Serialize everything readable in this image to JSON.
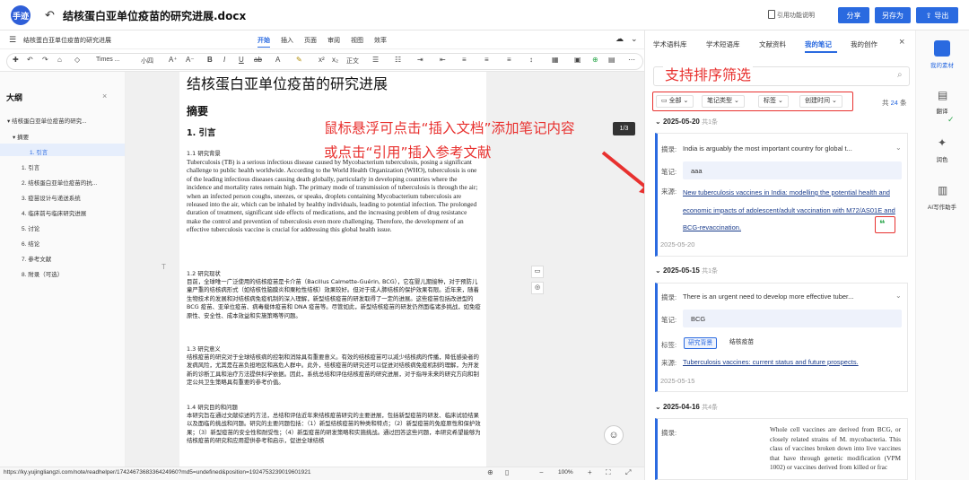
{
  "titlebar": {
    "logo": "手迹",
    "back_icon": "undo-icon",
    "title": "结核蛋白亚单位疫苗的研究进展.docx",
    "cite_help": "引用功能说明",
    "share": "分享",
    "save_as": "另存为",
    "export": "导出"
  },
  "doc_header": {
    "name": "结核蛋白亚单位疫苗的研究进展",
    "menu": [
      "开始",
      "插入",
      "页面",
      "审阅",
      "视图",
      "效率"
    ]
  },
  "toolbar": {
    "font": "Times ...",
    "size": "小四",
    "align": "正文"
  },
  "outline": {
    "title": "大纲",
    "items": [
      "结核蛋白亚单位疫苗的研究...",
      "摘要",
      "1. 引言",
      "1. 引言",
      "2. 结核蛋白亚单位疫苗的抗...",
      "3. 疫苗设计与递送系统",
      "4. 临床前与临床研究进展",
      "5. 讨论",
      "6. 结论",
      "7. 参考文献",
      "8. 附录（可选）"
    ]
  },
  "document": {
    "title": "结核蛋白亚单位疫苗的研究进展",
    "abstract": "摘要",
    "h1": "1.  引言",
    "s11": "1.1 研究背景",
    "p11": "Tuberculosis (TB) is a serious infectious disease caused by Mycobacterium tuberculosis, posing a significant challenge to public health worldwide. According to the World Health Organization (WHO), tuberculosis is one of the leading infectious diseases causing death globally, particularly in developing countries where the incidence and mortality rates remain high. The primary mode of transmission of tuberculosis is through the air; when an infected person coughs, sneezes, or speaks, droplets containing Mycobacterium tuberculosis are released into the air, which can be inhaled by healthy individuals, leading to potential infection. The prolonged duration of treatment, significant side effects of medications, and the increasing problem of drug resistance make the control and prevention of tuberculosis even more challenging. Therefore, the development of an effective tuberculosis vaccine is crucial for addressing this global health issue.",
    "s12": "1.2 研究现状",
    "p12": "目前，全球唯一广泛使用的结核疫苗是卡介苗（Bacillus Calmette-Guérin, BCG），它在婴儿期接种，对于预防儿童严重的结核病形式（如结核性脑膜炎和粟粒性结核）效果较好。但对于成人肺结核的保护效果有限。近年来，随着生物技术的发展和对结核病免疫机制的深入理解，新型结核疫苗的研发取得了一定的进展。这些疫苗包括改进型的 BCG 疫苗、亚单位疫苗、病毒载体疫苗和 DNA 疫苗等。尽管如此，新型结核疫苗的研发仍然面临诸多挑战，如免疫原性、安全性、成本效益和实施策略等问题。",
    "s13": "1.3 研究意义",
    "p13": "结核疫苗的研究对于全球结核病的控制和消除具有重要意义。有效的结核疫苗可以减少结核病的传播，降低感染者的发病风险，尤其是在高负担地区和高危人群中。此外，结核疫苗的研究还可以促进对结核病免疫机制的理解，为开发新的诊断工具和治疗方法提供科学依据。因此，系统总结和评估结核疫苗的研究进展，对于指导未来的研究方向和制定公共卫生策略具有重要的参考价值。",
    "s14": "1.4 研究目的和问题",
    "p14": "本研究旨在通过文献综述的方法，总结和评估近年来结核疫苗研究的主要进展，包括新型疫苗的研发、临床试验结果以及面临的挑战和问题。研究的主要问题包括：（1）新型结核疫苗的种类和特点；（2）新型疫苗的免疫原性和保护效果；（3）新型疫苗的安全性和耐受性；（4）新型疫苗的研发策略和实施挑战。通过回答这些问题，本研究希望能够为结核疫苗的研究和应用提供参考和启示，促进全球结核"
  },
  "annotation": {
    "arrow_text_1": "鼠标悬浮可点击“插入文档”添加笔记内容",
    "arrow_text_2": "或点击“引用”插入参考文献",
    "sort_text": "支持排序筛选",
    "page_badge": "1/3"
  },
  "status": {
    "url": "https://ky.yujingliangzi.com/note/readhelper/1742467368336424960?md5=undefined&position=1924753239019601921",
    "zoom": "100%"
  },
  "rpanel": {
    "tabs": [
      "学术语料库",
      "学术短语库",
      "文献资料",
      "我的笔记",
      "我的创作"
    ],
    "search_placeholder": "",
    "filters": [
      "全部",
      "笔记类型",
      "标签",
      "创建时间"
    ],
    "total_prefix": "共",
    "total": "24",
    "total_suffix": "条",
    "groups": [
      {
        "date": "2025-05-20",
        "count": "共1条"
      },
      {
        "date": "2025-05-15",
        "count": "共1条"
      },
      {
        "date": "2025-04-16",
        "count": "共4条"
      }
    ],
    "card1": {
      "excerpt_label": "摘录:",
      "excerpt": "India is arguably the most important country for global t...",
      "note_label": "笔记:",
      "note": "aaa",
      "source_label": "来源:",
      "source": "New tuberculosis vaccines in India: modelling the potential health and economic impacts of adolescent/adult vaccination with M72/AS01E and BCG-revaccination.",
      "date": "2025-05-20"
    },
    "card2": {
      "excerpt_label": "摘录:",
      "excerpt": "There is an urgent need to develop more effective tuber...",
      "note_label": "笔记:",
      "note": "BCG",
      "tag_label": "标签:",
      "tags": [
        "研究背景",
        "结核疫苗"
      ],
      "source_label": "来源:",
      "source": "Tuberculosis vaccines: current status and future prospects.",
      "date": "2025-05-15"
    },
    "card3": {
      "excerpt_label": "摘录:",
      "excerpt": "Whole cell vaccines are derived from BCG, or closely related strains of M. mycobacteria. This class of vaccines broken down into live vaccines that have through genetic modification (VPM 1002) or vaccines derived from killed or frac"
    }
  },
  "sidebar": {
    "items": [
      "我的素材",
      "翻译",
      "润色",
      "AI写作助手"
    ]
  },
  "colors": {
    "accent": "#2a6ae0",
    "annotation_red": "#e8312f"
  }
}
